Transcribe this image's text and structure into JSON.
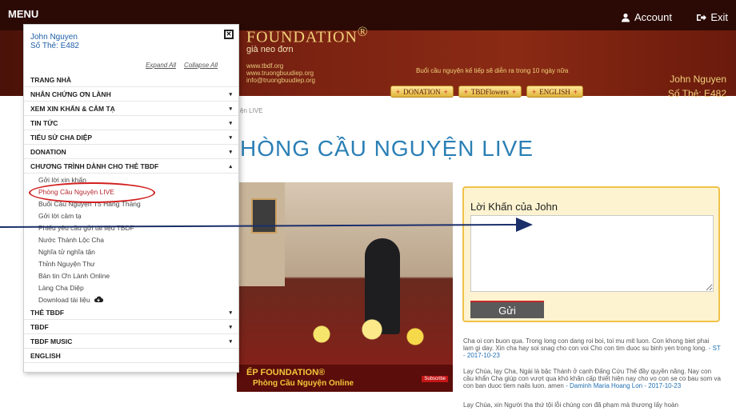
{
  "topbar": {
    "menu_label": "MENU",
    "account_label": "Account",
    "exit_label": "Exit"
  },
  "header": {
    "logo_tail": "FOUNDATION",
    "logo_mark": "®",
    "logo_sub": "già neo đơn",
    "contact": [
      "www.tbdf.org",
      "www.truongbuudiep.org",
      "info@truongbuudiep.org"
    ],
    "announcement": "Buổi cầu nguyện kế tiếp sẽ diễn ra trong 10 ngày nữa",
    "buttons": [
      "DONATION",
      "TBDFlowers",
      "ENGLISH"
    ],
    "user_name": "John Nguyen",
    "card_number": "Số Thẻ: E482"
  },
  "breadcrumb": "ện LIVE",
  "page_title": "HÒNG CẦU NGUYỆN LIVE",
  "video": {
    "caption_line1": "ẾP FOUNDATION®",
    "caption_line2": "Phòng Cầu Nguyện Online",
    "subscribe": "Subscribe"
  },
  "prayer_box": {
    "label": "Lời Khấn của John",
    "textarea_value": "",
    "send_label": "Gửi"
  },
  "messages": [
    {
      "text": "Cha oi con buon qua. Trong long con dang roi boi, toi mu mit luon. Con khong biet phai lam gi day. Xin cha hay soi snag cho con voi Cho con tim duoc su binh yen trong long.",
      "author": " - ST - 2017-10-23"
    },
    {
      "text": "Lạy Chúa, lạy Cha, Ngài là bậc Thánh ở cạnh Đấng Cứu Thế đầy quyền năng. Nay con cầu khẩn Cha giúp con vượt qua khó khăn cấp thiết hiện nay cho vo con se co bau som va con ban duoc tiem nails luon. amen",
      "author": " - Daminh Maria Hoang Lon - 2017-10-23"
    },
    {
      "text": "Lạy Chúa, xin Người tha thứ tội lỗi chúng con đã phạm mà thương lấy hoàn",
      "author": ""
    }
  ],
  "sidebar": {
    "user_name": "John Nguyen",
    "card_number": "Số Thẻ: E482",
    "expand_all": "Expand All",
    "collapse_all": "Collapse All",
    "items": [
      {
        "label": "TRANG NHÀ",
        "caret": ""
      },
      {
        "label": "NHÂN CHỨNG ƠN LÀNH",
        "caret": "▾"
      },
      {
        "label": "XEM XIN KHẤN & CẢM TẠ",
        "caret": "▾"
      },
      {
        "label": "TIN TỨC",
        "caret": "▾"
      },
      {
        "label": "TIỂU SỬ CHA DIỆP",
        "caret": "▾"
      },
      {
        "label": "DONATION",
        "caret": "▾"
      },
      {
        "label": "CHƯƠNG TRÌNH DÀNH CHO THẺ TBDF",
        "caret": "▴"
      }
    ],
    "subitems": [
      "Gởi lời xin khấn",
      "Phòng Cầu Nguyện LIVE",
      "Buổi Cầu Nguyện T5 Hàng Tháng",
      "Gởi lời cảm tạ",
      "Phiếu yêu cầu gửi tài liệu TBDF",
      "Nước Thánh Lộc Cha",
      "Nghĩa tử nghĩa tận",
      "Thỉnh Nguyện Thư",
      "Bản tin Ơn Lành Online",
      "Làng Cha Diệp",
      "Download tài liệu"
    ],
    "bottom_items": [
      {
        "label": "THẺ TBDF",
        "caret": "▾"
      },
      {
        "label": "TBDF",
        "caret": "▾"
      },
      {
        "label": "TBDF MUSIC",
        "caret": "▾"
      },
      {
        "label": "ENGLISH",
        "caret": ""
      }
    ]
  },
  "icons": {
    "account": "user-icon",
    "exit": "sign-out-icon",
    "download": "cloud-download-icon",
    "collapse": "collapse-icon"
  },
  "colors": {
    "brand_dark": "#2b0a05",
    "title_blue": "#2a7fb5",
    "gold": "#f1d27a",
    "active_red": "#b6282f"
  }
}
